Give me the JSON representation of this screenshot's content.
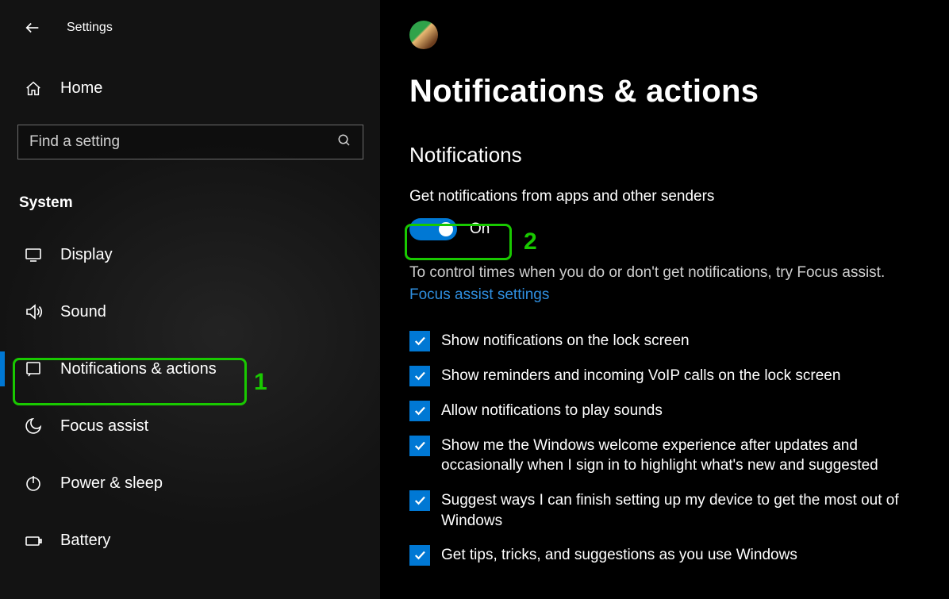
{
  "titlebar": {
    "app": "Settings"
  },
  "sidebar": {
    "home": "Home",
    "search_placeholder": "Find a setting",
    "section": "System",
    "items": [
      {
        "label": "Display"
      },
      {
        "label": "Sound"
      },
      {
        "label": "Notifications & actions"
      },
      {
        "label": "Focus assist"
      },
      {
        "label": "Power & sleep"
      },
      {
        "label": "Battery"
      }
    ]
  },
  "main": {
    "title": "Notifications & actions",
    "section": "Notifications",
    "get_label": "Get notifications from apps and other senders",
    "toggle_state": "On",
    "hint": "To control times when you do or don't get notifications, try Focus assist.",
    "link": "Focus assist settings",
    "checks": [
      "Show notifications on the lock screen",
      "Show reminders and incoming VoIP calls on the lock screen",
      "Allow notifications to play sounds",
      "Show me the Windows welcome experience after updates and occasionally when I sign in to highlight what's new and suggested",
      "Suggest ways I can finish setting up my device to get the most out of Windows",
      "Get tips, tricks, and suggestions as you use Windows"
    ]
  },
  "annotations": {
    "one": "1",
    "two": "2"
  }
}
